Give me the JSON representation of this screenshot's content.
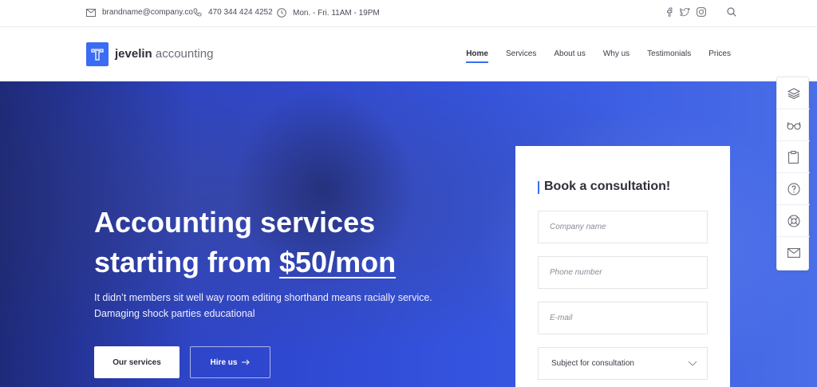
{
  "topbar": {
    "email": "brandname@company.co",
    "phone": "470 344 424 4252",
    "hours": "Mon. - Fri. 11AM - 19PM",
    "social_icons": [
      "facebook-icon",
      "twitter-icon",
      "instagram-icon"
    ],
    "search_icon": "search-icon"
  },
  "header": {
    "logo_bold": "jevelin",
    "logo_light": "accounting",
    "nav": [
      {
        "label": "Home",
        "active": true
      },
      {
        "label": "Services",
        "active": false
      },
      {
        "label": "About us",
        "active": false
      },
      {
        "label": "Why us",
        "active": false
      },
      {
        "label": "Testimonials",
        "active": false
      },
      {
        "label": "Prices",
        "active": false
      }
    ]
  },
  "hero": {
    "title_line1": "Accounting services",
    "title_line2_prefix": "starting from ",
    "title_price": "$50/mon",
    "subtitle": "It didn’t members sit well way room editing shorthand means racially service. Damaging shock parties educational",
    "primary_button": "Our services",
    "secondary_button": "Hire us"
  },
  "form": {
    "title": "Book a consultation!",
    "company_placeholder": "Company name",
    "phone_placeholder": "Phone number",
    "email_placeholder": "E-mail",
    "subject_label": "Subject for consultation"
  },
  "dock": {
    "items": [
      "layers-icon",
      "glasses-icon",
      "clipboard-icon",
      "help-icon",
      "lifebuoy-icon",
      "mail-icon"
    ]
  },
  "colors": {
    "accent": "#3a6cf4",
    "hero_blue": "#2f48d1"
  }
}
